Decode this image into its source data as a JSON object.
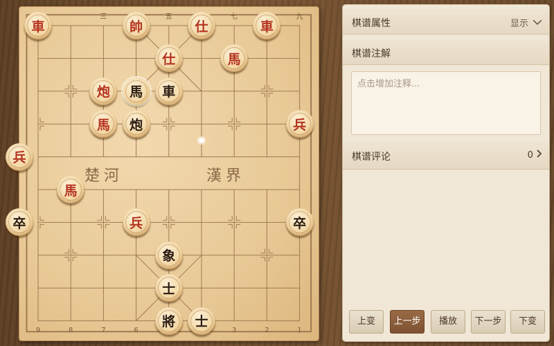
{
  "board": {
    "top_column_labels": [
      "一",
      "三",
      "五",
      "七",
      "九"
    ],
    "bottom_column_labels": [
      "9",
      "8",
      "7",
      "6",
      "5",
      "4",
      "3",
      "2",
      "1"
    ],
    "river_left": "楚河",
    "river_right": "漢界",
    "pieces": [
      {
        "glyph": "車",
        "color": "red",
        "col": 0,
        "row": 0
      },
      {
        "glyph": "帥",
        "color": "red",
        "col": 3,
        "row": 0
      },
      {
        "glyph": "仕",
        "color": "red",
        "col": 5,
        "row": 0
      },
      {
        "glyph": "車",
        "color": "red",
        "col": 7,
        "row": 0
      },
      {
        "glyph": "仕",
        "color": "red",
        "col": 4,
        "row": 1
      },
      {
        "glyph": "馬",
        "color": "red",
        "col": 6,
        "row": 1
      },
      {
        "glyph": "炮",
        "color": "red",
        "col": 2,
        "row": 2
      },
      {
        "glyph": "馬",
        "color": "black",
        "col": 3,
        "row": 2
      },
      {
        "glyph": "車",
        "color": "black",
        "col": 4,
        "row": 2
      },
      {
        "glyph": "馬",
        "color": "red",
        "col": 2,
        "row": 3
      },
      {
        "glyph": "炮",
        "color": "black",
        "col": 3,
        "row": 3
      },
      {
        "glyph": "兵",
        "color": "red",
        "col": 8,
        "row": 3
      },
      {
        "glyph": "兵",
        "color": "red",
        "col": -1,
        "row": 4
      },
      {
        "glyph": "馬",
        "color": "red",
        "col": 1,
        "row": 5
      },
      {
        "glyph": "卒",
        "color": "black",
        "col": -1,
        "row": 6
      },
      {
        "glyph": "兵",
        "color": "red",
        "col": 3,
        "row": 6
      },
      {
        "glyph": "卒",
        "color": "black",
        "col": 8,
        "row": 6
      },
      {
        "glyph": "象",
        "color": "black",
        "col": 4,
        "row": 7
      },
      {
        "glyph": "士",
        "color": "black",
        "col": 4,
        "row": 8
      },
      {
        "glyph": "將",
        "color": "black",
        "col": 4,
        "row": 9
      },
      {
        "glyph": "士",
        "color": "black",
        "col": 5,
        "row": 9
      }
    ]
  },
  "panel": {
    "properties_title": "棋谱属性",
    "show_toggle": "显示",
    "notes_title": "棋谱注解",
    "notes_placeholder": "点击增加注释...",
    "comments_title": "棋谱评论",
    "comments_count": "0"
  },
  "controls": {
    "prev_variation": "上变",
    "prev_step": "上一步",
    "play": "播放",
    "next_step": "下一步",
    "next_variation": "下变"
  },
  "colors": {
    "red_piece_text": "#b5331f",
    "black_piece_text": "#2b1d12",
    "active_button": "#8a5c3b"
  }
}
